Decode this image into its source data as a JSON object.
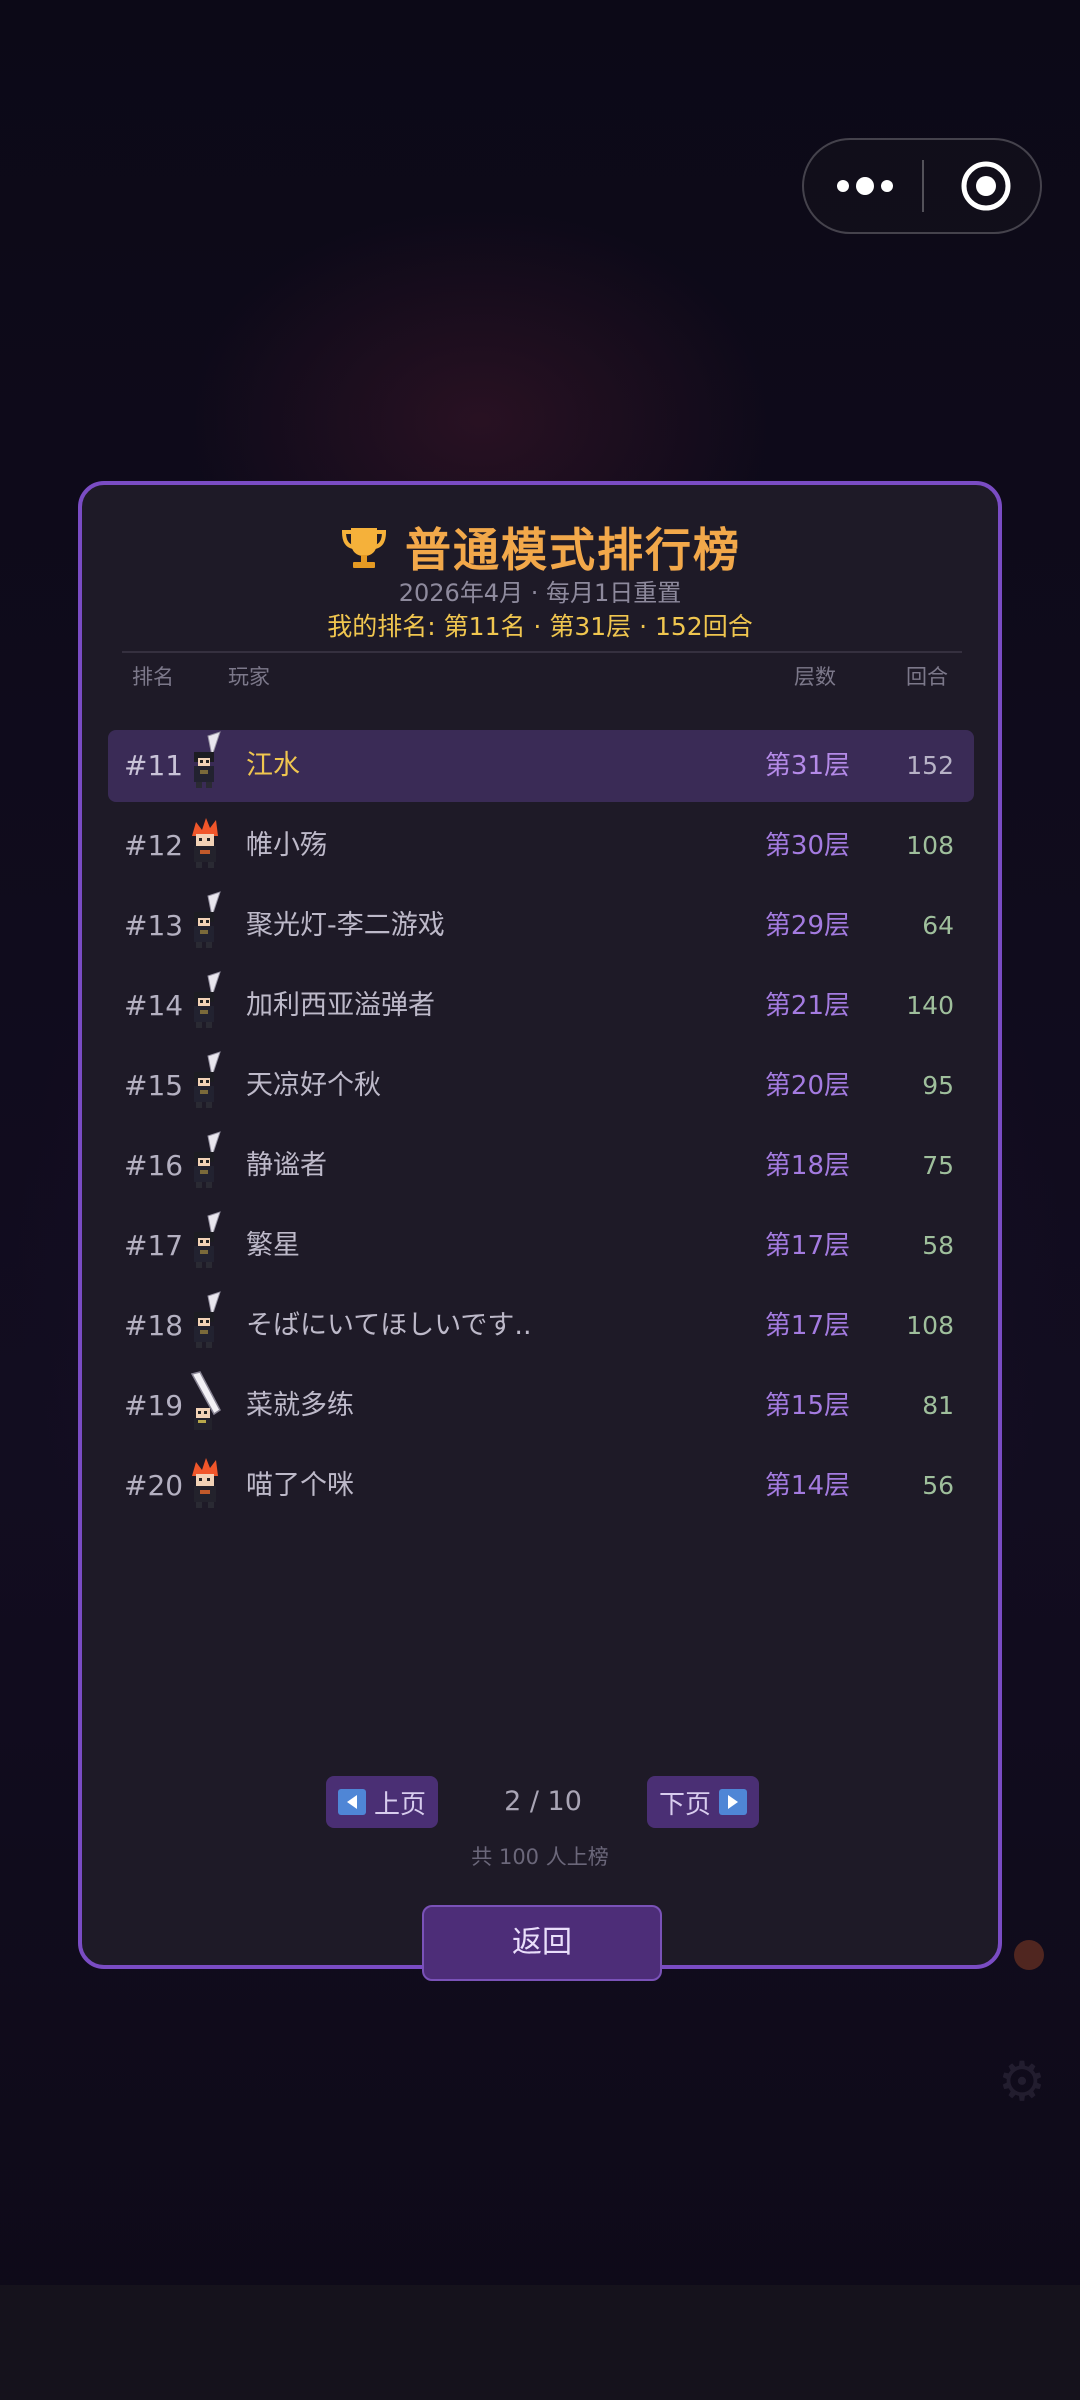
{
  "capsule": {
    "more_icon": "more-dots-icon",
    "close_icon": "target-circle-icon"
  },
  "leaderboard": {
    "title": "普通模式排行榜",
    "subtitle": "2026年4月 · 每月1日重置",
    "my_rank": "我的排名: 第11名 · 第31层 · 152回合",
    "columns": {
      "rank": "排名",
      "player": "玩家",
      "floor": "层数",
      "turns": "回合"
    },
    "rows": [
      {
        "rank": "#11",
        "name": "江水",
        "floor": "第31层",
        "turns": "152",
        "avatar": "knight-avatar-icon",
        "is_me": true
      },
      {
        "rank": "#12",
        "name": "帷小殇",
        "floor": "第30层",
        "turns": "108",
        "avatar": "fire-hair-avatar-icon",
        "is_me": false
      },
      {
        "rank": "#13",
        "name": "聚光灯-李二游戏",
        "floor": "第29层",
        "turns": "64",
        "avatar": "knight-avatar-icon",
        "is_me": false
      },
      {
        "rank": "#14",
        "name": "加利西亚溢弹者",
        "floor": "第21层",
        "turns": "140",
        "avatar": "knight-avatar-icon",
        "is_me": false
      },
      {
        "rank": "#15",
        "name": "天凉好个秋",
        "floor": "第20层",
        "turns": "95",
        "avatar": "knight-avatar-icon",
        "is_me": false
      },
      {
        "rank": "#16",
        "name": "静谧者",
        "floor": "第18层",
        "turns": "75",
        "avatar": "knight-avatar-icon",
        "is_me": false
      },
      {
        "rank": "#17",
        "name": "繁星",
        "floor": "第17层",
        "turns": "58",
        "avatar": "knight-avatar-icon",
        "is_me": false
      },
      {
        "rank": "#18",
        "name": "そばにいてほしいです..",
        "floor": "第17层",
        "turns": "108",
        "avatar": "knight-avatar-icon",
        "is_me": false
      },
      {
        "rank": "#19",
        "name": "菜就多练",
        "floor": "第15层",
        "turns": "81",
        "avatar": "greatsword-avatar-icon",
        "is_me": false
      },
      {
        "rank": "#20",
        "name": "喵了个咪",
        "floor": "第14层",
        "turns": "56",
        "avatar": "fire-hair-avatar-icon",
        "is_me": false
      }
    ],
    "pager": {
      "prev_label": "上页",
      "next_label": "下页",
      "page": "2 / 10"
    },
    "total": "共 100 人上榜",
    "back_label": "返回"
  },
  "colors": {
    "panel_border": "#7a4cc4",
    "title": "#f2a84a",
    "highlight": "#f0c64f",
    "floor": "#a47be0",
    "turns": "#9fbf9c"
  }
}
